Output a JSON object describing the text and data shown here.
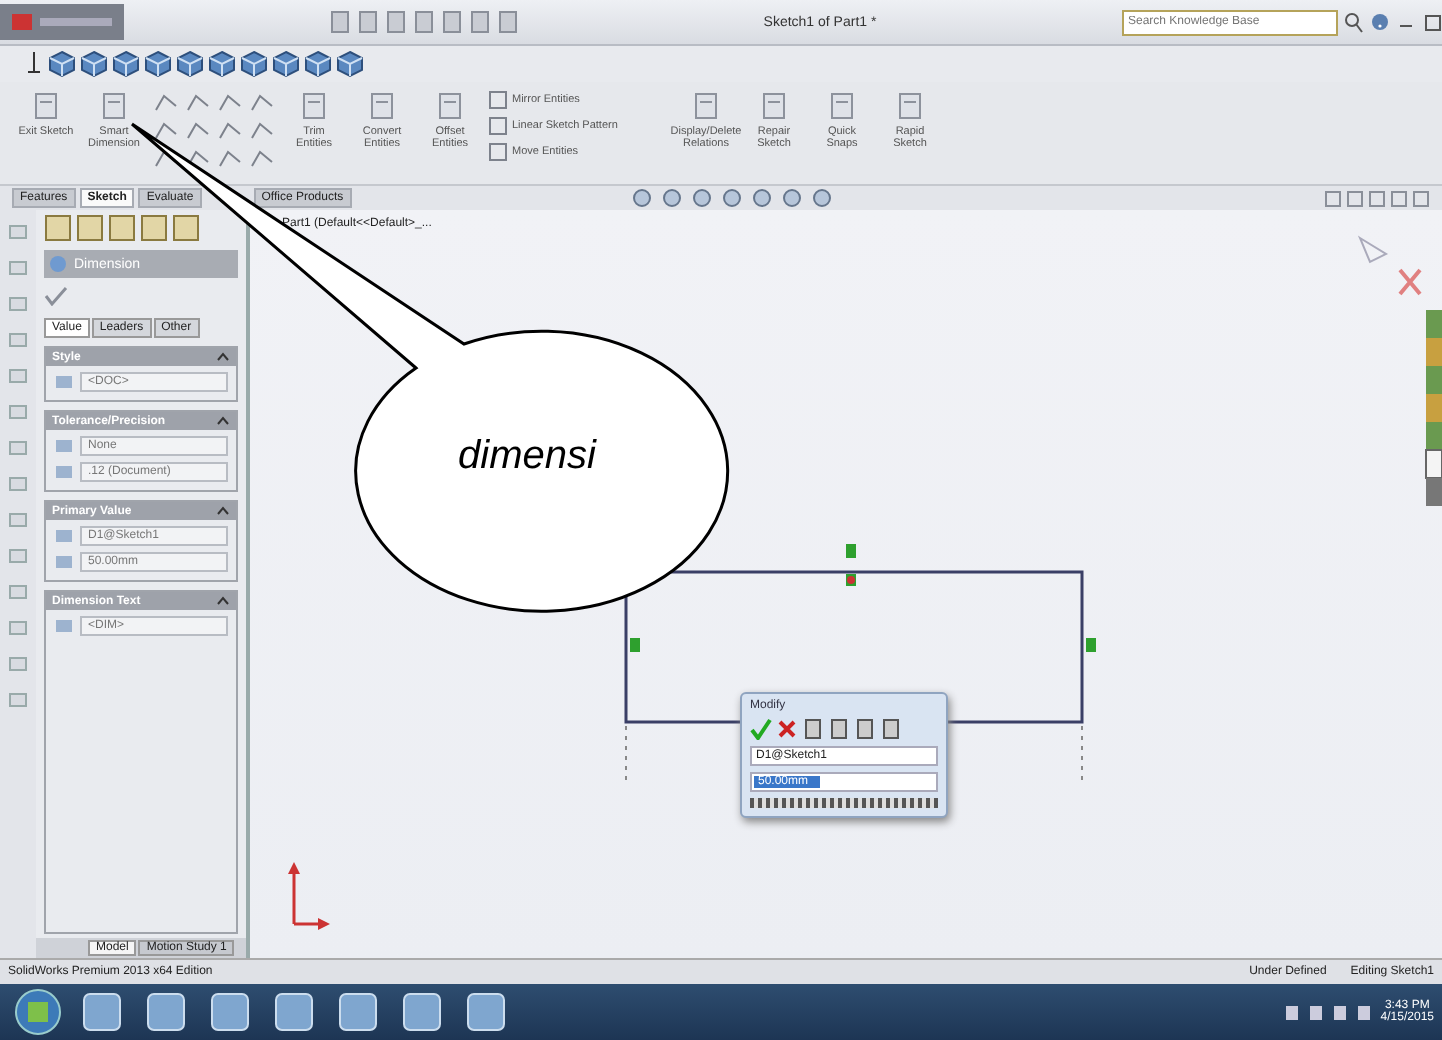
{
  "window": {
    "title": "Sketch1 of Part1 *",
    "search": {
      "placeholder": "Search Knowledge Base"
    }
  },
  "ribbon": [
    {
      "kind": "large",
      "label": "Exit Sketch"
    },
    {
      "kind": "large",
      "label": "Smart Dimension"
    },
    {
      "kind": "grid"
    },
    {
      "kind": "large",
      "label": "Trim Entities"
    },
    {
      "kind": "large",
      "label": "Convert Entities"
    },
    {
      "kind": "large",
      "label": "Offset Entities"
    },
    {
      "kind": "stack",
      "items": [
        "Mirror Entities",
        "Linear Sketch Pattern",
        "Move Entities"
      ]
    },
    {
      "kind": "large",
      "label": "Display/Delete Relations"
    },
    {
      "kind": "large",
      "label": "Repair Sketch"
    },
    {
      "kind": "large",
      "label": "Quick Snaps"
    },
    {
      "kind": "large",
      "label": "Rapid Sketch"
    }
  ],
  "command_tabs": [
    {
      "label": "Features",
      "selected": false
    },
    {
      "label": "Sketch",
      "selected": true
    },
    {
      "label": "Evaluate",
      "selected": false
    },
    {
      "label": "Office Products",
      "selected": false
    }
  ],
  "feature_tree": {
    "item": "Part1 (Default<<Default>_..."
  },
  "property_manager": {
    "title": "Dimension",
    "tabs": [
      {
        "label": "Value",
        "selected": true
      },
      {
        "label": "Leaders",
        "selected": false
      },
      {
        "label": "Other",
        "selected": false
      }
    ],
    "sections": [
      {
        "title": "Style",
        "fields": [
          "<DOC>"
        ]
      },
      {
        "title": "Tolerance/Precision",
        "fields": [
          "None",
          ".12 (Document)"
        ]
      },
      {
        "title": "Primary Value",
        "fields": [
          "D1@Sketch1",
          "50.00mm"
        ]
      },
      {
        "title": "Dimension Text",
        "fields": [
          "<DIM>"
        ]
      }
    ]
  },
  "modify_dialog": {
    "title": "Modify",
    "name": "D1@Sketch1",
    "value": "50.00mm"
  },
  "model_tabs": [
    {
      "label": "Model",
      "selected": true
    },
    {
      "label": "Motion Study 1",
      "selected": false
    }
  ],
  "status_bar": {
    "product": "SolidWorks Premium 2013 x64 Edition",
    "state": "Under Defined",
    "mode": "Editing Sketch1"
  },
  "taskbar": {
    "time": "3:43 PM",
    "date": "4/15/2015"
  },
  "callout": {
    "text": "dimensi"
  }
}
